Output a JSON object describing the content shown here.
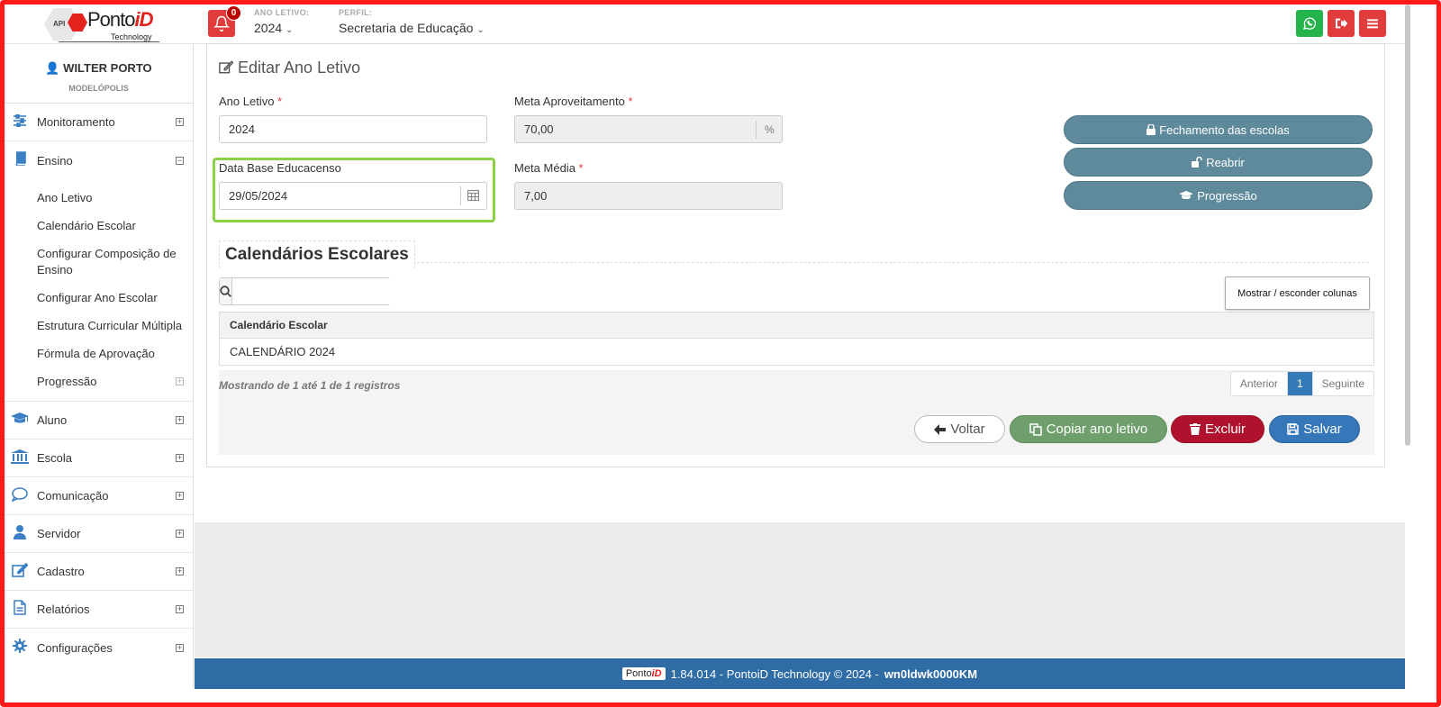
{
  "header": {
    "logo_api": "API",
    "logo_brand": "Ponto",
    "logo_brand_em": "iD",
    "logo_tech": "Technology",
    "notifications_count": "0",
    "school_year_label": "ANO LETIVO:",
    "school_year_value": "2024",
    "profile_label": "PERFIL:",
    "profile_value": "Secretaria de Educação",
    "whatsapp_color": "#25b34b",
    "logout_color": "#e03c3c",
    "menu_color": "#e03c3c"
  },
  "user": {
    "name": "WILTER PORTO",
    "city": "MODELÓPOLIS"
  },
  "sidebar": {
    "items": [
      {
        "label": "Monitoramento",
        "icon": "sliders-icon",
        "toggle": "+"
      },
      {
        "label": "Ensino",
        "icon": "book-icon",
        "toggle": "−"
      },
      {
        "label": "Aluno",
        "icon": "graduation-cap-icon",
        "toggle": "+"
      },
      {
        "label": "Escola",
        "icon": "bank-icon",
        "toggle": "+"
      },
      {
        "label": "Comunicação",
        "icon": "comment-icon",
        "toggle": "+"
      },
      {
        "label": "Servidor",
        "icon": "user-icon",
        "toggle": "+"
      },
      {
        "label": "Cadastro",
        "icon": "edit-icon",
        "toggle": "+"
      },
      {
        "label": "Relatórios",
        "icon": "file-icon",
        "toggle": "+"
      },
      {
        "label": "Configurações",
        "icon": "gear-icon",
        "toggle": "+"
      }
    ],
    "ensino_sub": [
      {
        "label": "Ano Letivo"
      },
      {
        "label": "Calendário Escolar"
      },
      {
        "label": "Configurar Composição de Ensino"
      },
      {
        "label": "Configurar Ano Escolar"
      },
      {
        "label": "Estrutura Curricular Múltipla"
      },
      {
        "label": "Fórmula de Aprovação"
      },
      {
        "label": "Progressão",
        "toggle": "+"
      }
    ]
  },
  "form": {
    "title": "Editar Ano Letivo",
    "ano_letivo_label": "Ano Letivo",
    "ano_letivo_value": "2024",
    "meta_aproveitamento_label": "Meta Aproveitamento",
    "meta_aproveitamento_value": "70,00",
    "meta_aproveitamento_unit": "%",
    "data_base_label": "Data Base Educacenso",
    "data_base_value": "29/05/2024",
    "meta_media_label": "Meta Média",
    "meta_media_value": "7,00",
    "required_mark": "*"
  },
  "actions": {
    "fechamento": "Fechamento das escolas",
    "reabrir": "Reabrir",
    "progressao": "Progressão"
  },
  "calendarios": {
    "title": "Calendários Escolares",
    "search_value": "",
    "toggle_columns": "Mostrar / esconder colunas",
    "columns": [
      "Calendário Escolar"
    ],
    "rows": [
      [
        "CALENDÁRIO 2024"
      ]
    ],
    "info": "Mostrando de 1 até 1 de 1 registros",
    "pager_prev": "Anterior",
    "pager_current": "1",
    "pager_next": "Seguinte"
  },
  "buttons": {
    "voltar": "Voltar",
    "copiar": "Copiar ano letivo",
    "excluir": "Excluir",
    "salvar": "Salvar"
  },
  "footer": {
    "logo_text": "Ponto",
    "logo_em": "iD",
    "version_text": "1.84.014 - PontoiD Technology © 2024 -",
    "server": "wn0ldwk0000KM"
  }
}
